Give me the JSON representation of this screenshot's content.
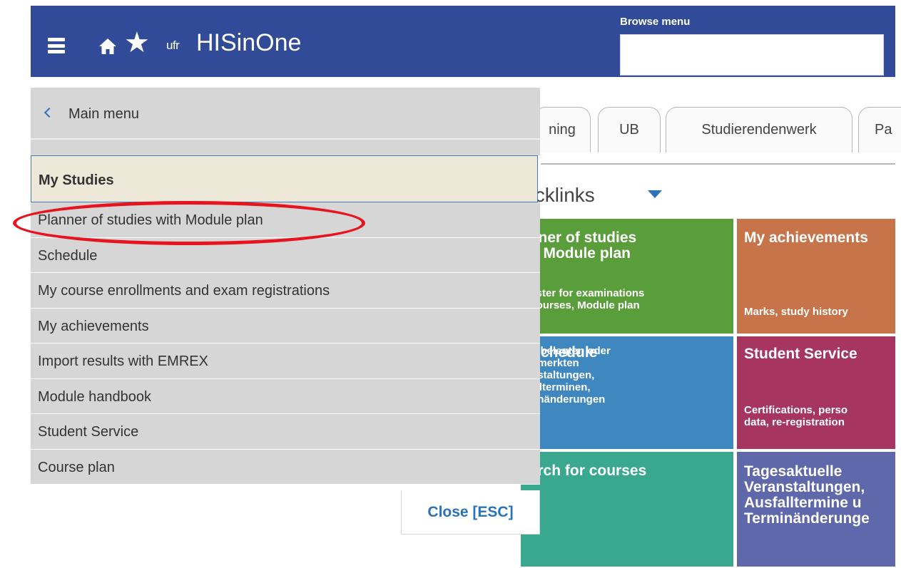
{
  "header": {
    "brand_small": "ufr",
    "brand": "HISinOne",
    "browse_label": "Browse menu",
    "browse_value": ""
  },
  "tabs": [
    {
      "label": "ning"
    },
    {
      "label": "UB"
    },
    {
      "label": "Studierendenwerk"
    },
    {
      "label": "Pa"
    }
  ],
  "quicklinks": {
    "title": "uicklinks",
    "tiles": [
      {
        "title": "anner of studies\nith Module plan",
        "subtitle": "egister for examinations\nd courses, Module plan",
        "color": "#5a9e3c"
      },
      {
        "title": "My achievements",
        "subtitle": "Marks, study history",
        "color": "#c8744a"
      },
      {
        "title": "chedule",
        "subtitle": "hre belegten oder\nrgemerkten\nranstaltungen,\nsfallterminen,\nrminänderungen",
        "color": "#3f87bf"
      },
      {
        "title": "Student Service",
        "subtitle": "Certifications, perso\ndata, re-registration",
        "color": "#a6365f"
      },
      {
        "title": "earch for courses",
        "subtitle": "",
        "color": "#3aa88e"
      },
      {
        "title": "Tagesaktuelle\nVeranstaltungen,\nAusfalltermine u\nTerminänderunge",
        "subtitle": "",
        "color": "#5e68aa"
      }
    ]
  },
  "menu": {
    "back_label": "Main menu",
    "section_title": "My Studies",
    "items": [
      {
        "label": "Planner of studies with Module plan"
      },
      {
        "label": "Schedule"
      },
      {
        "label": "My course enrollments and exam registrations"
      },
      {
        "label": "My achievements"
      },
      {
        "label": "Import results with EMREX"
      },
      {
        "label": "Module handbook"
      },
      {
        "label": "Student Service"
      },
      {
        "label": "Course plan"
      }
    ],
    "close_label": "Close [ESC]"
  },
  "annotation": {
    "color": "#e8141d",
    "target": "Planner of studies with Module plan"
  },
  "colors": {
    "header": "#314b99",
    "accent": "#2a73b8",
    "menu_bg": "#d6d6d6",
    "section_bg": "#eee8d8"
  }
}
